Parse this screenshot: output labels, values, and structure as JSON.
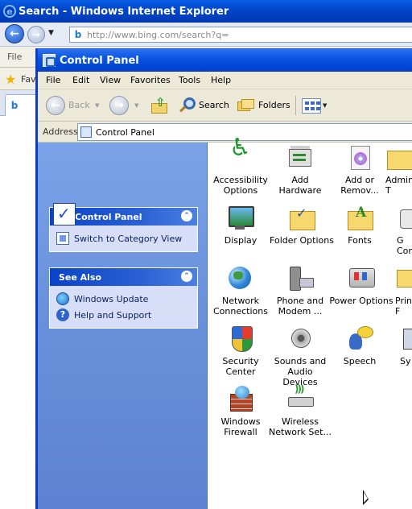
{
  "browser": {
    "title": "Search - Windows Internet Explorer",
    "address": "http://www.bing.com/search?q=",
    "menu_first": "File",
    "favorites_partial": "Fav",
    "tab_partial": "",
    "logo_letter": "e"
  },
  "window": {
    "title": "Control Panel"
  },
  "menubar": [
    "File",
    "Edit",
    "View",
    "Favorites",
    "Tools",
    "Help"
  ],
  "toolbar": {
    "back_label": "Back",
    "search_label": "Search",
    "folders_label": "Folders"
  },
  "address": {
    "label": "Address",
    "value": "Control Panel"
  },
  "sidebar": {
    "panel1_title": "Control Panel",
    "switch_view": "Switch to Category View",
    "see_also_title": "See Also",
    "see_also": [
      "Windows Update",
      "Help and Support"
    ]
  },
  "items": [
    {
      "name": "Accessibility\nOptions",
      "icon": "accessibility-icon"
    },
    {
      "name": "Add Hardware",
      "icon": "add-hardware-icon"
    },
    {
      "name": "Add or\nRemov...",
      "icon": "add-remove-programs-icon"
    },
    {
      "name": "Admin\nT",
      "icon": "administrative-tools-icon"
    },
    {
      "name": "Display",
      "icon": "display-icon"
    },
    {
      "name": "Folder Options",
      "icon": "folder-options-icon"
    },
    {
      "name": "Fonts",
      "icon": "fonts-icon"
    },
    {
      "name": "G\nCon",
      "icon": "game-controllers-icon"
    },
    {
      "name": "Network\nConnections",
      "icon": "network-connections-icon"
    },
    {
      "name": "Phone and\nModem ...",
      "icon": "phone-modem-icon"
    },
    {
      "name": "Power Options",
      "icon": "power-options-icon"
    },
    {
      "name": "Print\nF",
      "icon": "printers-faxes-icon"
    },
    {
      "name": "Security\nCenter",
      "icon": "security-center-icon"
    },
    {
      "name": "Sounds and\nAudio Devices",
      "icon": "sounds-audio-icon"
    },
    {
      "name": "Speech",
      "icon": "speech-icon"
    },
    {
      "name": "Sy",
      "icon": "system-icon"
    },
    {
      "name": "Windows\nFirewall",
      "icon": "windows-firewall-icon"
    },
    {
      "name": "Wireless\nNetwork Set...",
      "icon": "wireless-network-icon"
    }
  ]
}
